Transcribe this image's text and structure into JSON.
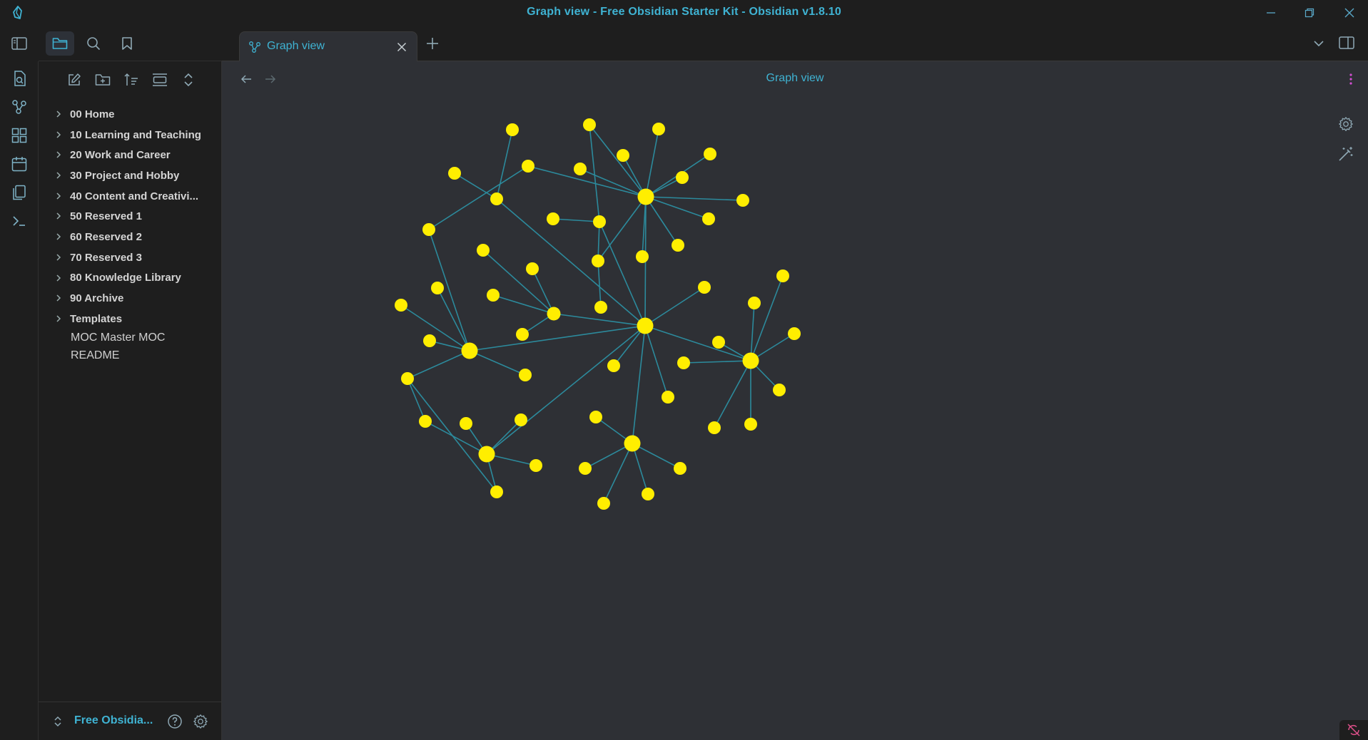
{
  "window": {
    "title": "Graph view - Free Obsidian Starter Kit - Obsidian v1.8.10"
  },
  "sidebar": {
    "folders": [
      {
        "label": "00 Home"
      },
      {
        "label": "10 Learning and Teaching"
      },
      {
        "label": "20 Work and Career"
      },
      {
        "label": "30 Project and Hobby"
      },
      {
        "label": "40 Content and Creativi..."
      },
      {
        "label": "50 Reserved 1"
      },
      {
        "label": "60 Reserved 2"
      },
      {
        "label": "70 Reserved 3"
      },
      {
        "label": "80 Knowledge Library"
      },
      {
        "label": "90 Archive"
      },
      {
        "label": "Templates"
      }
    ],
    "files": [
      {
        "label": "MOC Master MOC"
      },
      {
        "label": "README"
      }
    ],
    "vault_name": "Free Obsidia..."
  },
  "tabs": [
    {
      "label": "Graph view",
      "active": true
    }
  ],
  "view": {
    "title": "Graph view"
  },
  "colors": {
    "accent": "#3fb3d3",
    "node": "#ffee00",
    "edge": "#2c8a9c",
    "background": "#2e3035"
  },
  "graph": {
    "node_count": 62,
    "edge_count": 67
  }
}
